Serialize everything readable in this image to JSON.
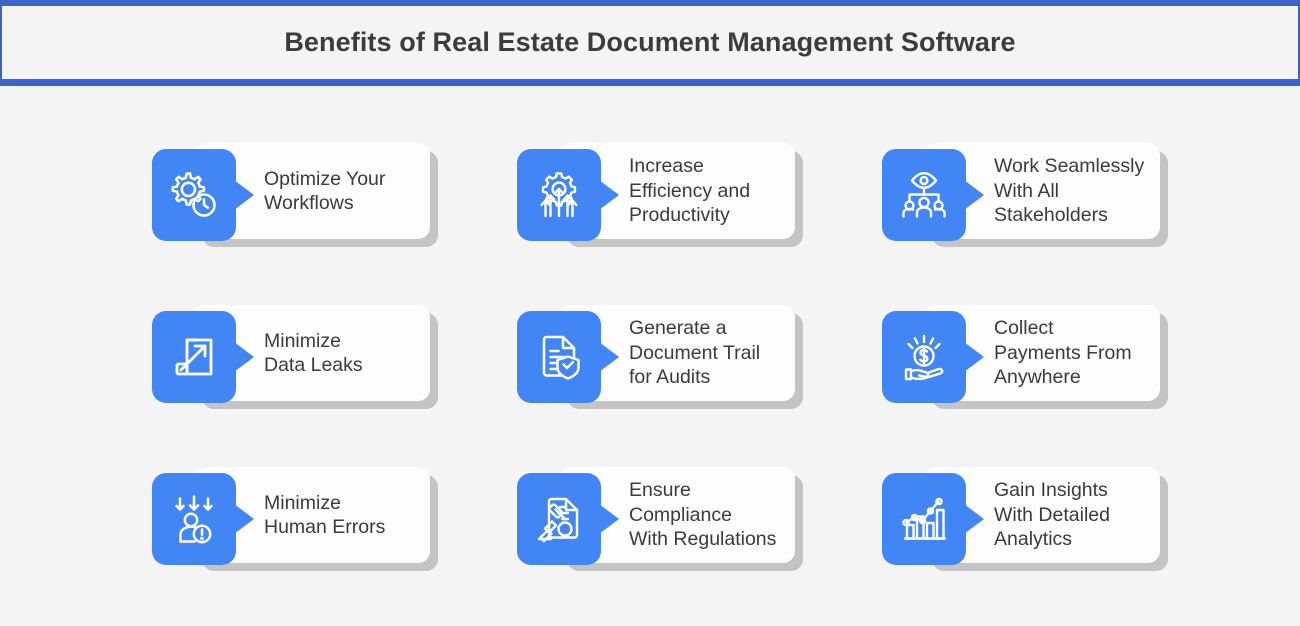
{
  "header": {
    "title": "Benefits of Real Estate Document Management Software",
    "border_color": "#3b63ca",
    "background": "#f4f4f4"
  },
  "theme": {
    "accent_blue": "#4285f4",
    "header_blue": "#3b63ca",
    "page_background": "#f4f4f4",
    "card_background": "#fdfdfd",
    "card_shadow": "#c4c4c4",
    "text_color": "#3b3b3b"
  },
  "benefits": [
    {
      "label": "Optimize Your\nWorkflows",
      "icon": "gear-clock-icon"
    },
    {
      "label": "Increase\nEfficiency and\nProductivity",
      "icon": "gear-arrows-up-icon"
    },
    {
      "label": "Work Seamlessly\nWith All\nStakeholders",
      "icon": "eye-team-hierarchy-icon"
    },
    {
      "label": "Minimize\nData Leaks",
      "icon": "square-expand-arrow-icon"
    },
    {
      "label": "Generate a\nDocument Trail\nfor Audits",
      "icon": "document-shield-check-icon"
    },
    {
      "label": "Collect\nPayments From\nAnywhere",
      "icon": "hand-dollar-coin-icon"
    },
    {
      "label": "Minimize\nHuman Errors",
      "icon": "person-down-arrows-alert-icon"
    },
    {
      "label": "Ensure\nCompliance\nWith Regulations",
      "icon": "gavel-document-icon"
    },
    {
      "label": "Gain Insights\nWith Detailed\nAnalytics",
      "icon": "bar-chart-trend-icon"
    }
  ]
}
